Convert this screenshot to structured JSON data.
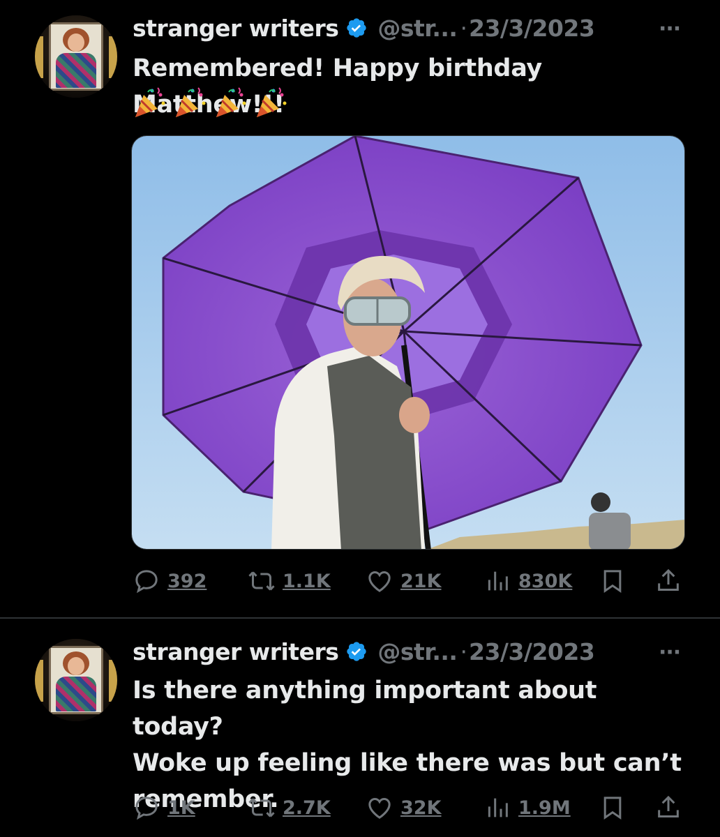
{
  "tweets": [
    {
      "author_name": "stranger writers",
      "handle": "@str...",
      "separator": "·",
      "date": "23/3/2023",
      "more": "···",
      "text": "Remembered! Happy birthday Matthew!!!",
      "emoji": [
        "party-popper",
        "party-popper",
        "party-popper",
        "party-popper"
      ],
      "media": {
        "description_icon": "photo"
      },
      "replies": "392",
      "retweets": "1.1K",
      "likes": "21K",
      "views": "830K"
    },
    {
      "author_name": "stranger writers",
      "handle": "@str...",
      "separator": "·",
      "date": "23/3/2023",
      "more": "···",
      "text_lines": [
        "Is there anything important about today?",
        "Woke up feeling like there was but can’t",
        "remember."
      ],
      "replies": "1K",
      "retweets": "2.7K",
      "likes": "32K",
      "views": "1.9M"
    }
  ],
  "colors": {
    "background": "#000000",
    "text": "#e7e9ea",
    "muted": "#71767b",
    "verified": "#1d9bf0",
    "divider": "#2f3336"
  }
}
